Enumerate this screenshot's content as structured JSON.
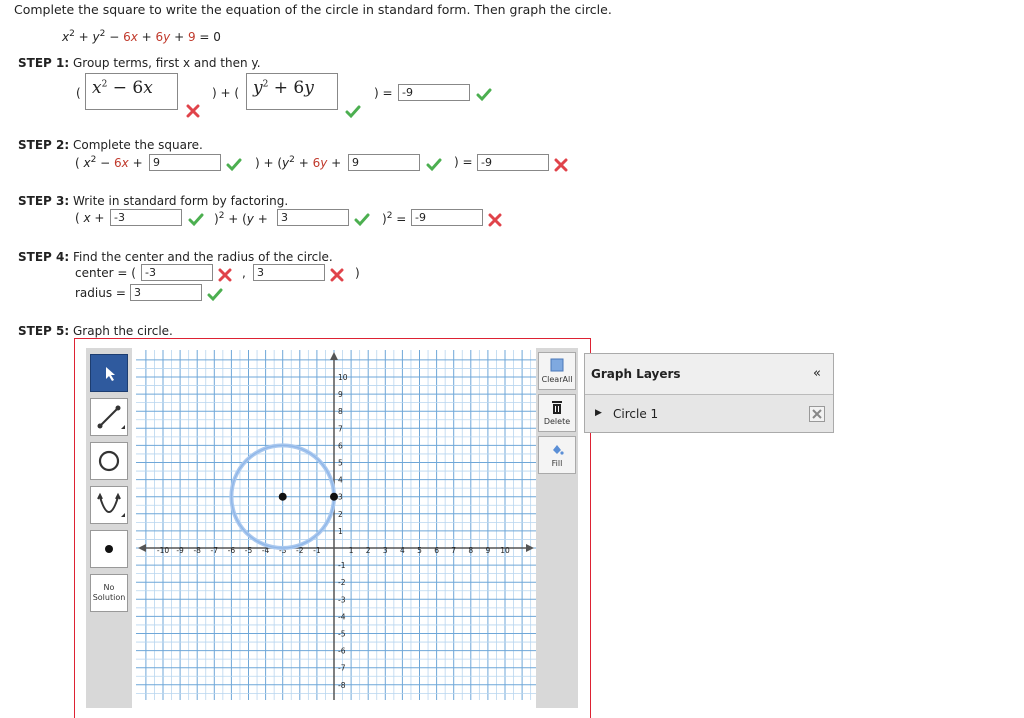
{
  "prompt": "Complete the square to write the equation of the circle in standard form. Then graph the circle.",
  "equation": {
    "a": "x",
    "b": "y",
    "rest1": " − ",
    "c": "6x",
    "d": " + ",
    "e": "6y",
    "f": " + ",
    "g": "9",
    "h": " = 0"
  },
  "step1": {
    "label": "STEP 1:",
    "text": "Group terms, first x and then y.",
    "box1": "x² − 6x",
    "box2": "y² + 6y",
    "rhs": "-9"
  },
  "step2": {
    "label": "STEP 2:",
    "text": "Complete the square.",
    "v1": "9",
    "v2": "9",
    "v3": "-9"
  },
  "step3": {
    "label": "STEP 3:",
    "text": "Write in standard form by factoring.",
    "v1": "-3",
    "v2": "3",
    "v3": "-9"
  },
  "step4": {
    "label": "STEP 4:",
    "text": "Find the center and the radius of the circle.",
    "center_label": "center =",
    "cx": "-3",
    "cy": "3",
    "radius_label": "radius =",
    "r": "3"
  },
  "step5": {
    "label": "STEP 5:",
    "text": "Graph the circle."
  },
  "tools": {
    "no_solution": "No Solution"
  },
  "right_tools": {
    "clear_all": "ClearAll",
    "delete": "Delete",
    "fill": "Fill"
  },
  "layers": {
    "title": "Graph Layers",
    "collapse": "«",
    "item": "Circle 1"
  },
  "graph": {
    "x_ticks": [
      "-10",
      "-9",
      "-8",
      "-7",
      "-6",
      "-5",
      "-4",
      "-3",
      "-2",
      "-1",
      "1",
      "2",
      "3",
      "4",
      "5",
      "6",
      "7",
      "8",
      "9",
      "10"
    ],
    "y_ticks": [
      "10",
      "9",
      "8",
      "7",
      "6",
      "5",
      "4",
      "3",
      "2",
      "1",
      "-1",
      "-2",
      "-3",
      "-4",
      "-5",
      "-6",
      "-7",
      "-8"
    ],
    "circle": {
      "cx": -3,
      "cy": 3,
      "r": 3
    },
    "points": [
      {
        "x": -3,
        "y": 3
      },
      {
        "x": 0,
        "y": 3
      }
    ]
  }
}
